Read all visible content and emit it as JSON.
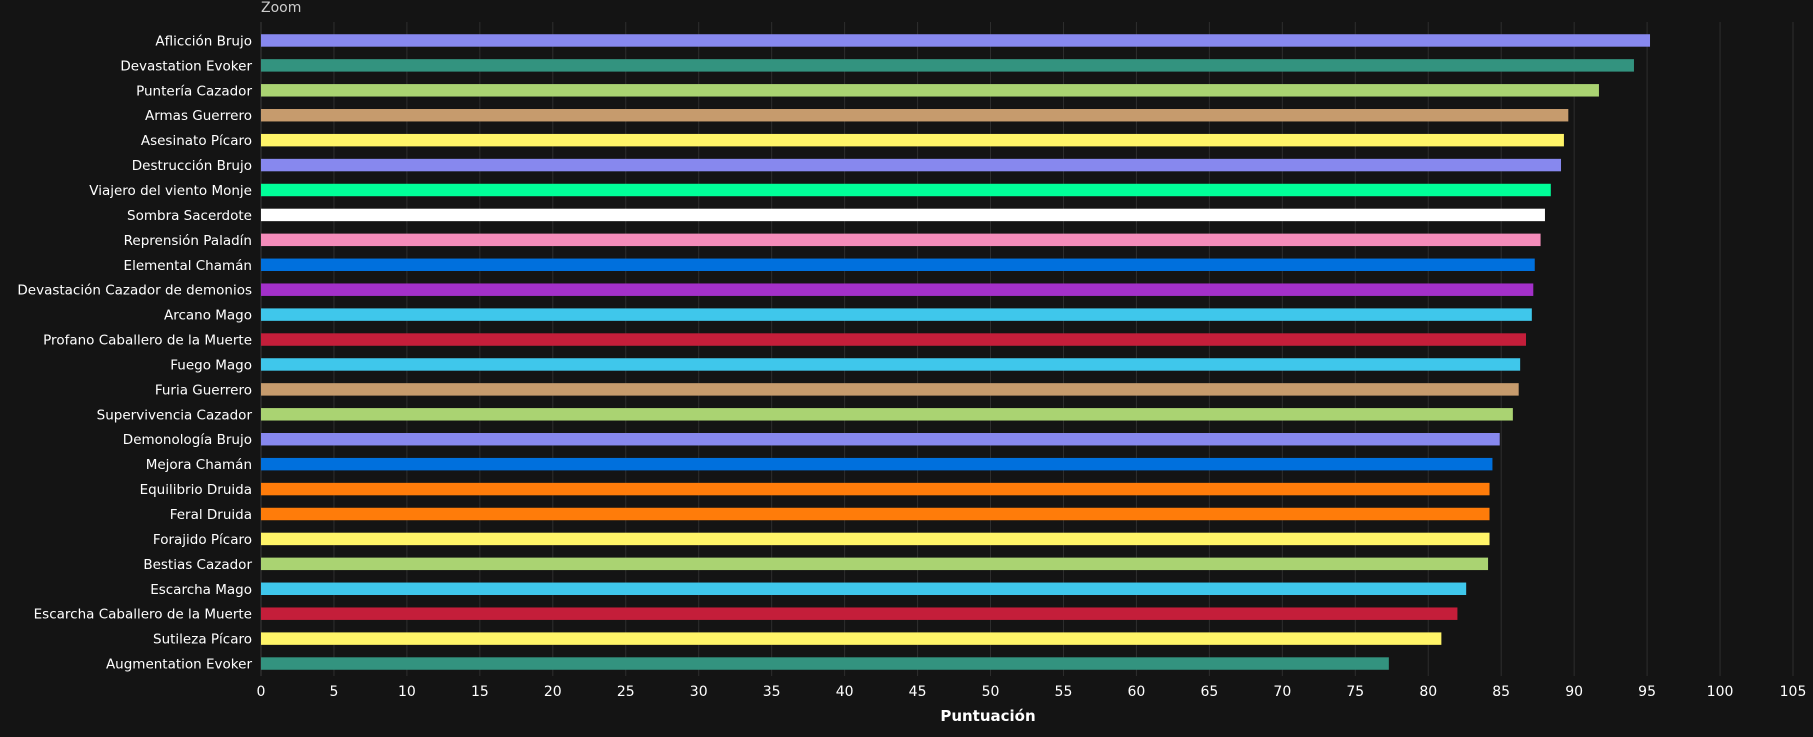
{
  "zoom_label": "Zoom",
  "chart_data": {
    "type": "bar",
    "orientation": "horizontal",
    "xlabel": "Puntuación",
    "ylabel": "",
    "xlim": [
      0,
      105
    ],
    "xticks": [
      0,
      5,
      10,
      15,
      20,
      25,
      30,
      35,
      40,
      45,
      50,
      55,
      60,
      65,
      70,
      75,
      80,
      85,
      90,
      95,
      100,
      105
    ],
    "grid": true,
    "legend": "none",
    "categories": [
      "Aflicción Brujo",
      "Devastation Evoker",
      "Puntería Cazador",
      "Armas Guerrero",
      "Asesinato Pícaro",
      "Destrucción Brujo",
      "Viajero del viento Monje",
      "Sombra Sacerdote",
      "Reprensión Paladín",
      "Elemental Chamán",
      "Devastación Cazador de demonios",
      "Arcano Mago",
      "Profano Caballero de la Muerte",
      "Fuego Mago",
      "Furia Guerrero",
      "Supervivencia Cazador",
      "Demonología Brujo",
      "Mejora Chamán",
      "Equilibrio Druida",
      "Feral Druida",
      "Forajido Pícaro",
      "Bestias Cazador",
      "Escarcha Mago",
      "Escarcha Caballero de la Muerte",
      "Sutileza Pícaro",
      "Augmentation Evoker"
    ],
    "values": [
      95.2,
      94.1,
      91.7,
      89.6,
      89.3,
      89.1,
      88.4,
      88.0,
      87.7,
      87.3,
      87.2,
      87.1,
      86.7,
      86.3,
      86.2,
      85.8,
      84.9,
      84.4,
      84.2,
      84.2,
      84.2,
      84.1,
      82.6,
      82.0,
      80.9,
      77.3
    ],
    "colors": [
      "#8788EE",
      "#33937F",
      "#AAD372",
      "#C69B6D",
      "#FFF468",
      "#8788EE",
      "#00FF98",
      "#FFFFFF",
      "#F48CBA",
      "#0070DD",
      "#A330C9",
      "#3FC7EB",
      "#C41E3A",
      "#3FC7EB",
      "#C69B6D",
      "#AAD372",
      "#8788EE",
      "#0070DD",
      "#FF7C0A",
      "#FF7C0A",
      "#FFF468",
      "#AAD372",
      "#3FC7EB",
      "#C41E3A",
      "#FFF468",
      "#33937F"
    ]
  }
}
